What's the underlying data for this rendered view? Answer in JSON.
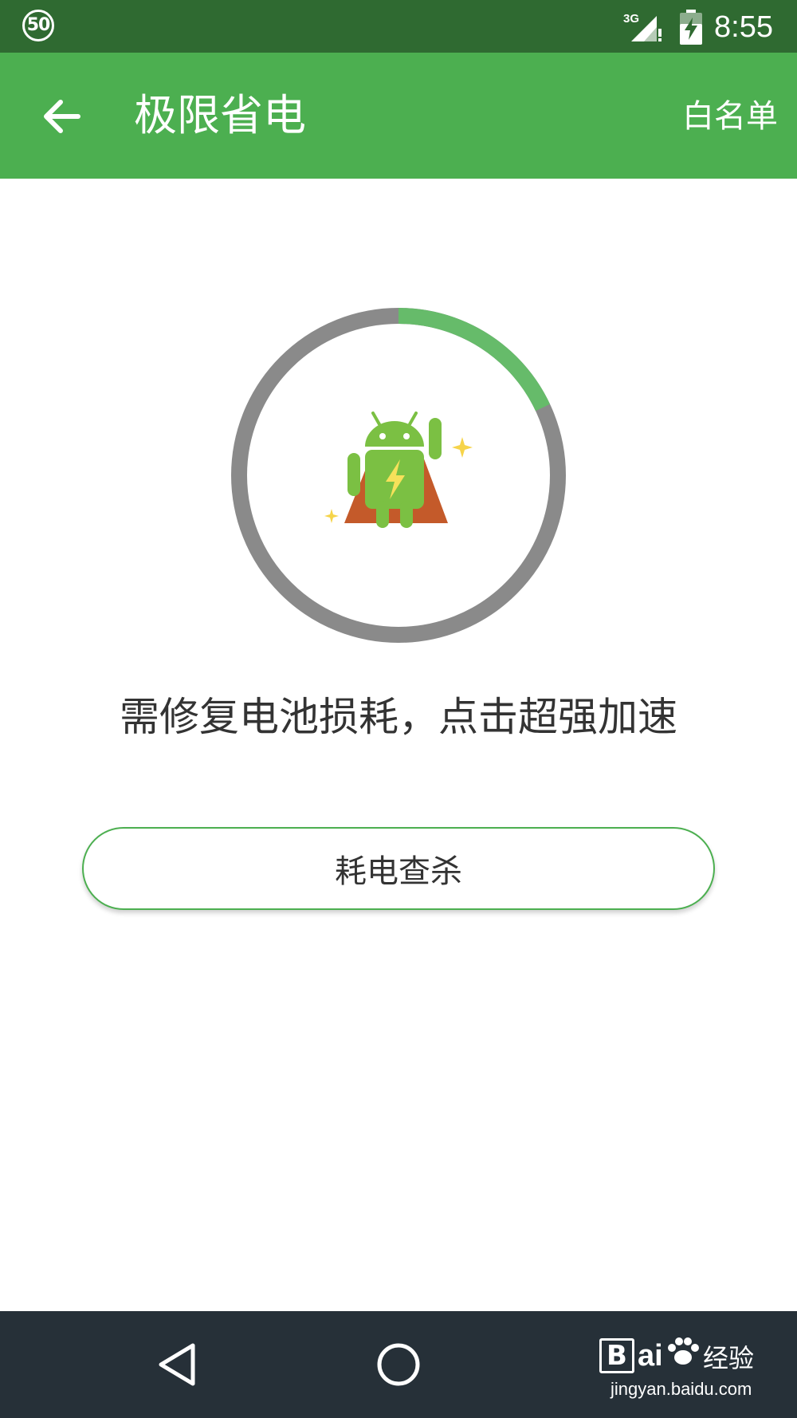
{
  "status_bar": {
    "badge": "50",
    "network": "3G",
    "time": "8:55"
  },
  "app_bar": {
    "title": "极限省电",
    "action_label": "白名单",
    "back_icon": "arrow-left-icon"
  },
  "main": {
    "progress_fraction": 0.18,
    "progress_color": "#66bb6a",
    "ring_track_color": "#8a8a8a",
    "mascot_icon": "android-hero-icon",
    "hint": "需修复电池损耗，点击超强加速",
    "scan_button_label": "耗电查杀"
  },
  "nav_bar": {
    "icons": [
      "back-triangle-icon",
      "home-circle-icon"
    ]
  },
  "watermark": {
    "box_letter": "B",
    "brand": "ai",
    "brand_cn": "经验",
    "url": "jingyan.baidu.com"
  },
  "colors": {
    "status_bar": "#2f6a31",
    "app_bar": "#4caf50",
    "nav_bar": "#263038",
    "accent": "#4caf50"
  }
}
